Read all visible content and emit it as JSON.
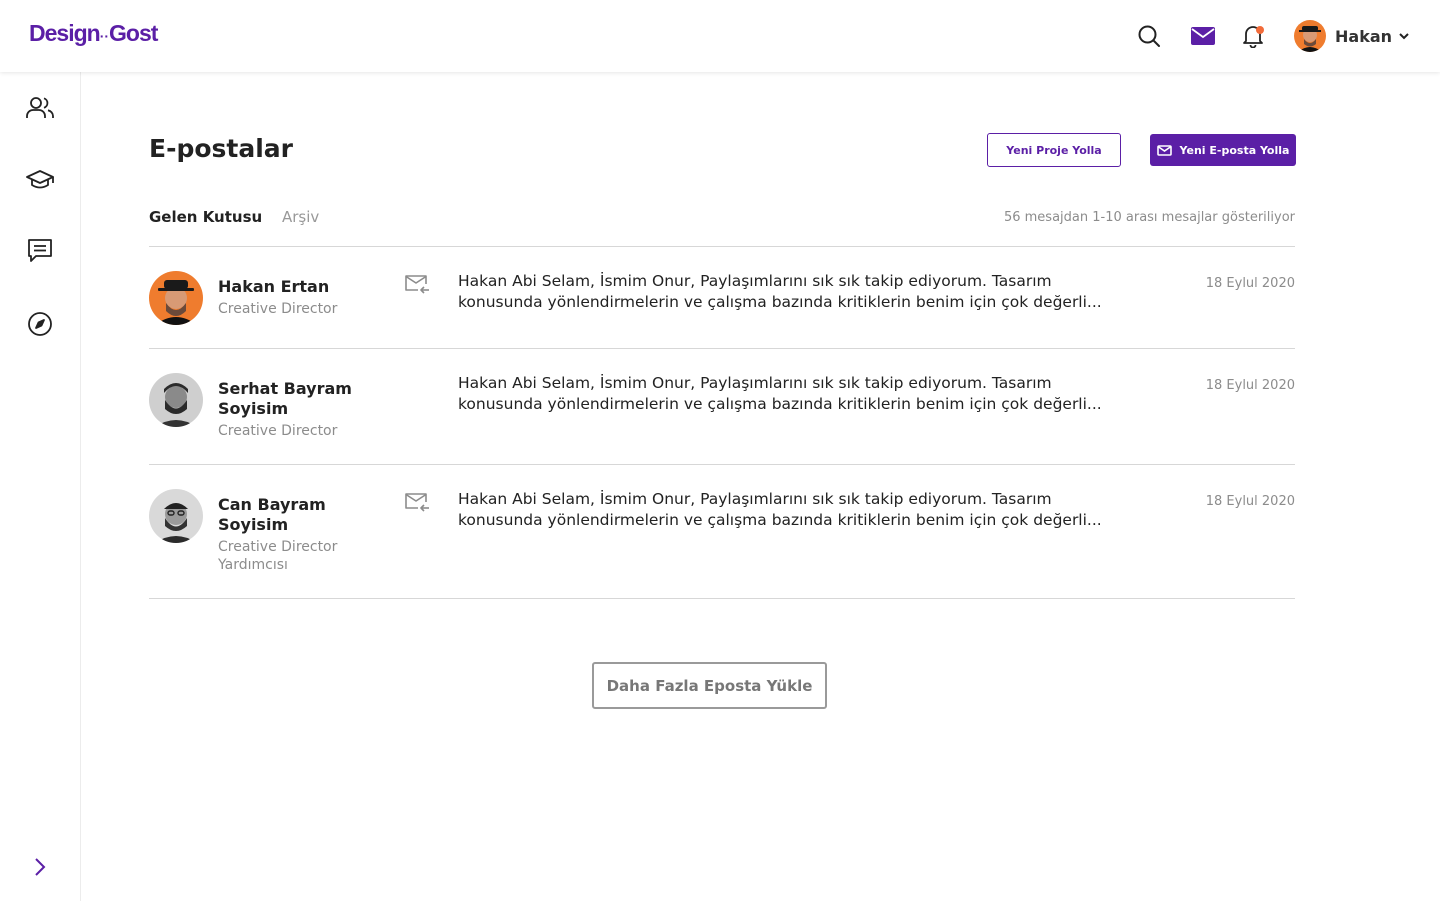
{
  "brand": {
    "name": "Design",
    "dots": "··",
    "name2": "Gost"
  },
  "header": {
    "user_name": "Hakan",
    "icons": [
      "search-icon",
      "mail-icon",
      "bell-icon",
      "chevron-down-icon"
    ]
  },
  "sidebar": {
    "items": [
      "users-icon",
      "graduation-cap-icon",
      "chat-icon",
      "compass-icon"
    ],
    "expand": "chevron-right-icon"
  },
  "page": {
    "title": "E-postalar",
    "btn_project": "Yeni Proje Yolla",
    "btn_email": "Yeni E-posta Yolla",
    "tabs": [
      "Gelen Kutusu",
      "Arşiv"
    ],
    "count": "56 mesajdan 1-10 arası mesajlar gösteriliyor",
    "load_more": "Daha Fazla Eposta Yükle"
  },
  "messages": [
    {
      "name": "Hakan Ertan",
      "role": "Creative Director",
      "has_attachment_icon": true,
      "preview": "Hakan Abi Selam, İsmim Onur, Paylaşımlarını sık sık takip ediyorum. Tasarım konusunda yönlendirmelerin ve çalışma bazında kritiklerin benim için çok değerli...",
      "date": "18 Eylul 2020"
    },
    {
      "name": "Serhat Bayram Soyisim",
      "role": "Creative Director",
      "has_attachment_icon": false,
      "preview": "Hakan Abi Selam, İsmim Onur, Paylaşımlarını sık sık takip ediyorum. Tasarım konusunda yönlendirmelerin ve çalışma bazında kritiklerin benim için çok değerli...",
      "date": "18 Eylul 2020"
    },
    {
      "name": "Can Bayram Soyisim",
      "role": "Creative Director Yardımcısı",
      "has_attachment_icon": true,
      "preview": "Hakan Abi Selam, İsmim Onur, Paylaşımlarını sık sık takip ediyorum. Tasarım konusunda yönlendirmelerin ve çalışma bazında kritiklerin benim için çok değerli...",
      "date": "18 Eylul 2020"
    }
  ],
  "colors": {
    "accent": "#5b1fa6",
    "notification": "#f26b3a",
    "muted": "#8c8c8c",
    "divider": "#d7d7d7"
  }
}
